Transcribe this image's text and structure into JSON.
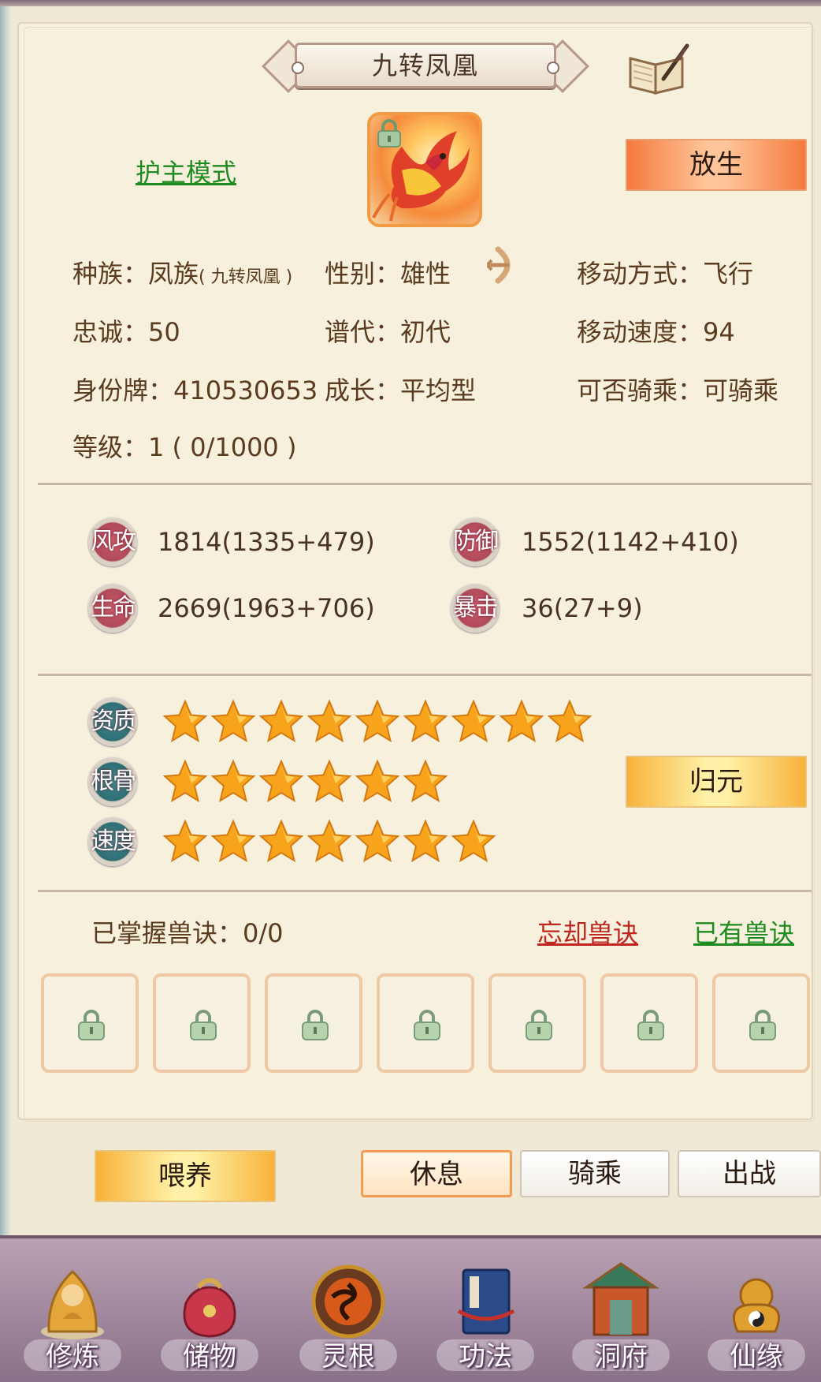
{
  "pet": {
    "name": "九转凤凰",
    "mode_link": "护主模式",
    "release_button": "放生",
    "info": {
      "race_label": "种族：",
      "race_value": "凤族",
      "race_sub": "( 九转凤凰 )",
      "gender_label": "性别：",
      "gender_value": "雄性",
      "move_label": "移动方式：",
      "move_value": "飞行",
      "loyalty_label": "忠诚：",
      "loyalty_value": "50",
      "gen_label": "谱代：",
      "gen_value": "初代",
      "speed_label": "移动速度：",
      "speed_value": "94",
      "id_label": "身份牌：",
      "id_value": "410530653",
      "growth_label": "成长：",
      "growth_value": "平均型",
      "ride_label": "可否骑乘：",
      "ride_value": "可骑乘",
      "level_label": "等级：",
      "level_value": "1 ( 0/1000 )"
    },
    "stats": [
      {
        "label": "风攻",
        "value": "1814(1335+479)"
      },
      {
        "label": "防御",
        "value": "1552(1142+410)"
      },
      {
        "label": "生命",
        "value": "2669(1963+706)"
      },
      {
        "label": "暴击",
        "value": "36(27+9)"
      }
    ],
    "attributes": [
      {
        "label": "资质",
        "stars": 9
      },
      {
        "label": "根骨",
        "stars": 6
      },
      {
        "label": "速度",
        "stars": 7
      }
    ],
    "reset_button": "归元",
    "skills_label": "已掌握兽诀：0/0",
    "forget_link": "忘却兽诀",
    "owned_link": "已有兽诀",
    "skill_slot_count": 7
  },
  "actions": {
    "feed": "喂养",
    "rest": "休息",
    "ride": "骑乘",
    "battle": "出战"
  },
  "nav": [
    {
      "label": "修炼",
      "icon": "cultivate-icon"
    },
    {
      "label": "储物",
      "icon": "storage-bag-icon"
    },
    {
      "label": "灵根",
      "icon": "spirit-root-icon"
    },
    {
      "label": "功法",
      "icon": "scripture-book-icon"
    },
    {
      "label": "洞府",
      "icon": "cave-house-icon"
    },
    {
      "label": "仙缘",
      "icon": "immortal-fate-icon"
    }
  ],
  "colors": {
    "accent_orange": "#f47a3d",
    "link_green": "#1f8a1f",
    "link_red": "#c0261f",
    "star": "#f7a41c"
  }
}
